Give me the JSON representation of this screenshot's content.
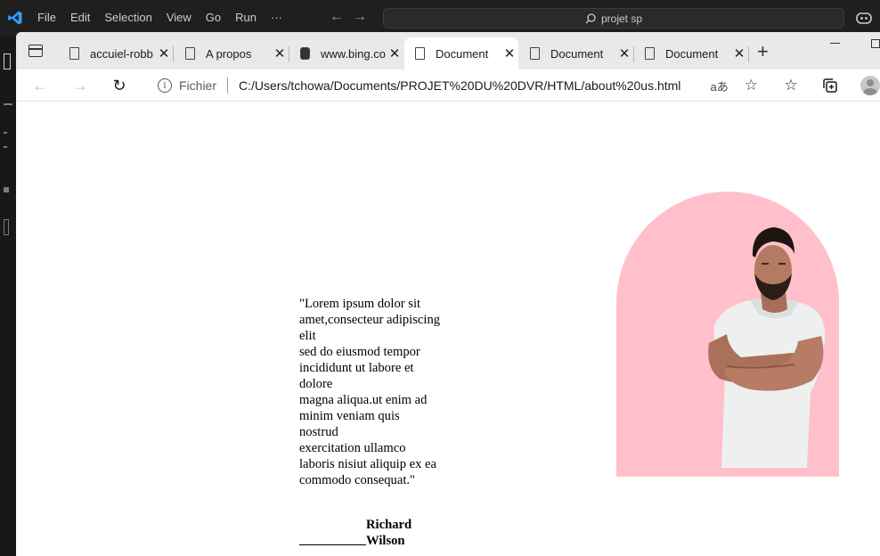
{
  "vscode": {
    "menu": [
      "File",
      "Edit",
      "Selection",
      "View",
      "Go",
      "Run",
      "···"
    ],
    "search_text": "projet sp"
  },
  "browser": {
    "tabs": [
      {
        "label": "accuiel-robb",
        "active": false
      },
      {
        "label": "A propos",
        "active": false
      },
      {
        "label": "www.bing.co",
        "active": false
      },
      {
        "label": "Document",
        "active": true
      },
      {
        "label": "Document",
        "active": false
      },
      {
        "label": "Document",
        "active": false
      }
    ],
    "address": {
      "scheme": "Fichier",
      "url": "C:/Users/tchowa/Documents/PROJET%20DU%20DVR/HTML/about%20us.html",
      "translate_label": "aあ"
    }
  },
  "page": {
    "quote": "\"Lorem ipsum dolor sit amet,consecteur adipiscing elit\nsed do eiusmod tempor incididunt ut labore et dolore\nmagna aliqua.ut enim ad minim veniam quis nostrud\nexercitation ullamco laboris nisiut aliquip ex ea\ncommodo consequat.\"",
    "author": "Richard Wilson",
    "accent_color": "#ffc0cb"
  },
  "icons": [
    "vscode-logo-icon",
    "search-icon",
    "copilot-icon",
    "tab-actions-icon",
    "document-icon",
    "bing-icon",
    "close-icon",
    "new-tab-icon",
    "back-icon",
    "forward-icon",
    "refresh-icon",
    "info-icon",
    "add-favorite-icon",
    "favorites-icon",
    "collections-icon",
    "profile-icon"
  ]
}
